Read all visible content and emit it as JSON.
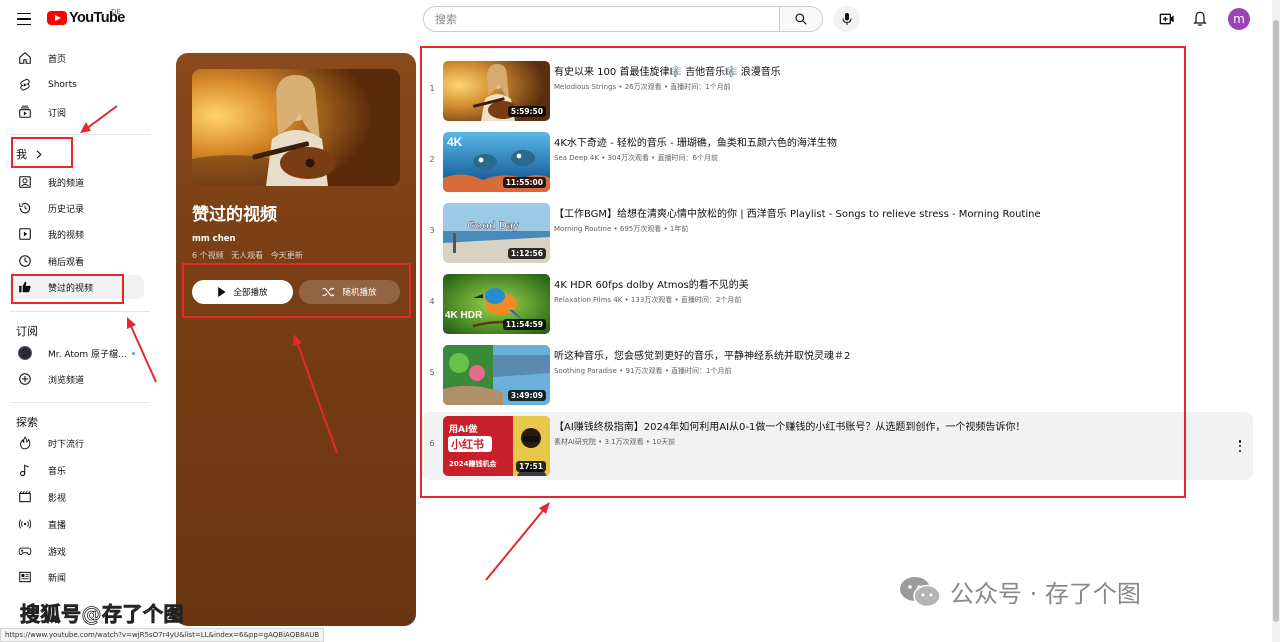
{
  "header": {
    "logo_text": "YouTube",
    "region": "DE",
    "search_placeholder": "搜索"
  },
  "sidebar": {
    "top_items": [
      {
        "label": "首页",
        "icon": "home-icon"
      },
      {
        "label": "Shorts",
        "icon": "shorts-icon"
      },
      {
        "label": "订阅",
        "icon": "subscriptions-icon"
      }
    ],
    "you_section": "我",
    "you_items": [
      {
        "label": "我的频道",
        "icon": "channel-icon"
      },
      {
        "label": "历史记录",
        "icon": "history-icon"
      },
      {
        "label": "我的视频",
        "icon": "my-videos-icon"
      },
      {
        "label": "稍后观看",
        "icon": "watch-later-icon"
      },
      {
        "label": "赞过的视频",
        "icon": "thumbs-up-icon"
      }
    ],
    "subs_section": "订阅",
    "subs_items": [
      {
        "label": "Mr. Atom 原子檔...",
        "icon": "channel-avatar"
      },
      {
        "label": "浏览频道",
        "icon": "add-circle-icon"
      }
    ],
    "explore_section": "探索",
    "explore_items": [
      {
        "label": "时下流行",
        "icon": "trending-icon"
      },
      {
        "label": "音乐",
        "icon": "music-icon"
      },
      {
        "label": "影视",
        "icon": "film-icon"
      },
      {
        "label": "直播",
        "icon": "live-icon"
      },
      {
        "label": "游戏",
        "icon": "gaming-icon"
      },
      {
        "label": "新闻",
        "icon": "news-icon"
      }
    ]
  },
  "playlist": {
    "title": "赞过的视频",
    "owner": "mm chen",
    "video_count": "6 个视频",
    "views": "无人观看",
    "updated": "今天更新",
    "play_all": "全部播放",
    "shuffle": "随机播放"
  },
  "videos": [
    {
      "index": "1",
      "title": "有史以来 100 首最佳旋律🎼 吉他音乐🎼 浪漫音乐",
      "channel": "Melodious Strings",
      "views": "26万次观看",
      "time": "直播时间：1个月前",
      "duration": "5:59:50"
    },
    {
      "index": "2",
      "title": "4K水下奇迹 - 轻松的音乐 - 珊瑚礁，鱼类和五颜六色的海洋生物",
      "channel": "Sea Deep 4K",
      "views": "304万次观看",
      "time": "直播时间：6个月前",
      "duration": "11:55:00"
    },
    {
      "index": "3",
      "title": "【工作BGM】给想在清爽心情中放松的你 | 西洋音乐 Playlist - Songs to relieve stress - Morning Routine",
      "channel": "Morning Routine",
      "views": "695万次观看",
      "time": "1年前",
      "duration": "1:12:56"
    },
    {
      "index": "4",
      "title": "4K HDR 60fps dolby Atmos的看不见的美",
      "channel": "Relaxation Films 4K",
      "views": "133万次观看",
      "time": "直播时间：2个月前",
      "duration": "11:54:59"
    },
    {
      "index": "5",
      "title": "听这种音乐，您会感觉到更好的音乐，平静神经系统并取悦灵魂＃2",
      "channel": "Soothing Paradise",
      "views": "91万次观看",
      "time": "直播时间：1个月前",
      "duration": "3:49:09"
    },
    {
      "index": "6",
      "title": "【AI赚钱终极指南】2024年如何利用AI从0-1做一个赚钱的小红书账号？从选题到创作，一个视频告诉你！",
      "channel": "素材AI研究院",
      "views": "3.1万次观看",
      "time": "10天前",
      "duration": "17:51"
    }
  ],
  "thumb_text": {
    "t2": "4K",
    "t3": "Good Day",
    "t4": "4K HDR",
    "t6_a": "用AI做",
    "t6_b": "小红书",
    "t6_c": "2024赚钱机会"
  },
  "avatar_letter": "m",
  "status_url": "https://www.youtube.com/watch?v=wjR5sO7r4yU&list=LL&index=6&pp=gAQBiAQB8AUB",
  "watermarks": {
    "left": "搜狐号@存了个图",
    "right": "公众号 · 存了个图"
  },
  "colors": {
    "brand": "#ff0000",
    "annotation": "#e5282b",
    "panel": "#7a3f15"
  }
}
